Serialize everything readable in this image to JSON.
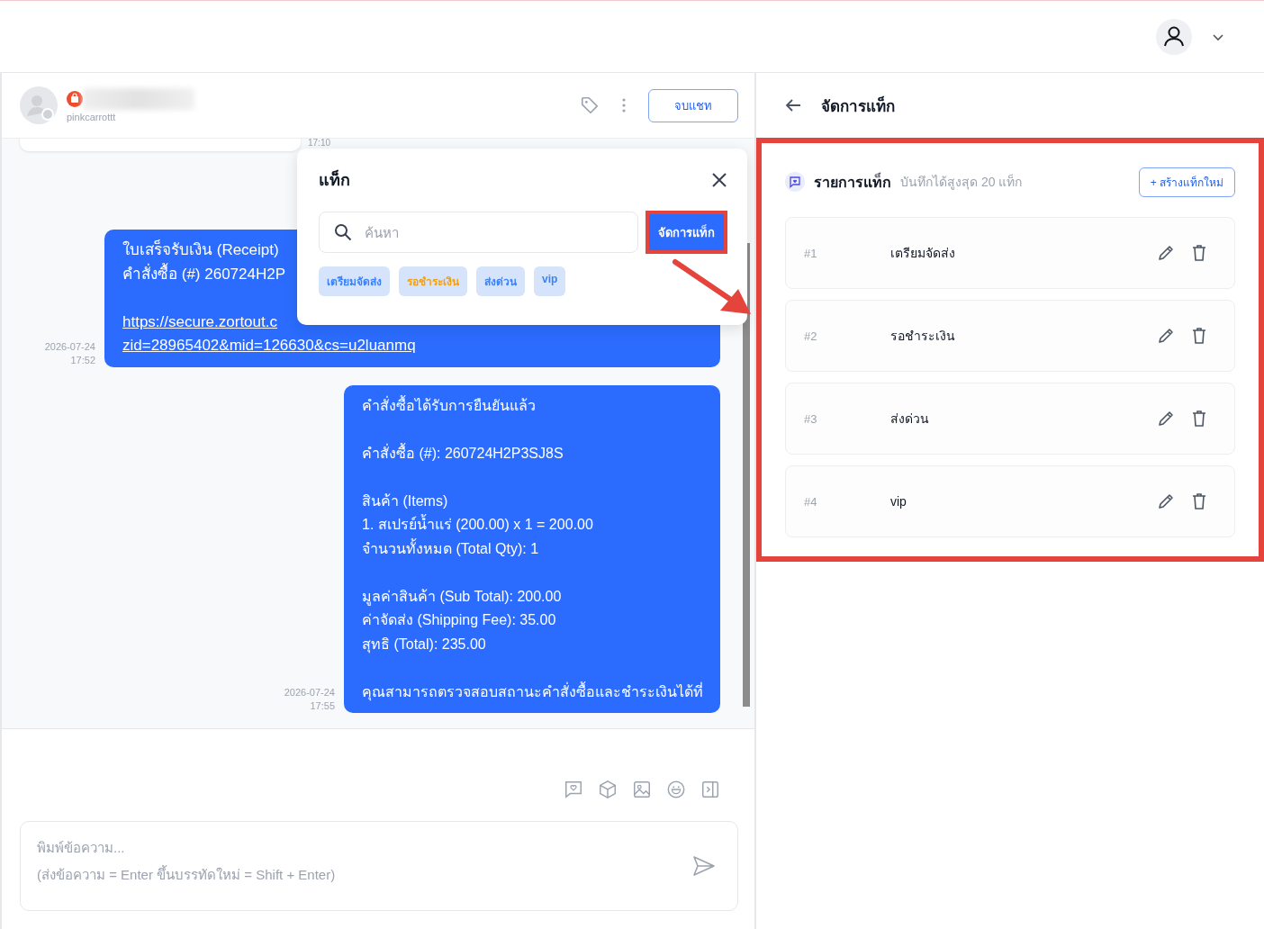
{
  "chat": {
    "contact": {
      "username": "pinkcarrottt"
    },
    "end_chat_button": "จบแชท",
    "messages": [
      {
        "kind": "cut_card",
        "time": "17:10"
      },
      {
        "kind": "bubble",
        "date": "2026-07-24",
        "time": "17:52",
        "lines": [
          {
            "kind": "text",
            "text": "ใบเสร็จรับเงิน (Receipt)"
          },
          {
            "kind": "text",
            "text": "คำสั่งซื้อ (#) 260724H2P"
          },
          {
            "kind": "gap"
          },
          {
            "kind": "link",
            "text": "https://secure.zortout.c"
          },
          {
            "kind": "link",
            "text": "zid=28965402&mid=126630&cs=u2luanmq"
          }
        ]
      },
      {
        "kind": "bubble",
        "date": "2026-07-24",
        "time": "17:55",
        "lines": [
          {
            "kind": "text",
            "text": "คำสั่งซื้อได้รับการยืนยันแล้ว"
          },
          {
            "kind": "gap"
          },
          {
            "kind": "text",
            "text": "คำสั่งซื้อ (#): 260724H2P3SJ8S"
          },
          {
            "kind": "gap"
          },
          {
            "kind": "text",
            "text": "สินค้า (Items)"
          },
          {
            "kind": "text",
            "text": "1. สเปรย์น้ำแร่ (200.00) x 1 = 200.00"
          },
          {
            "kind": "text",
            "text": "จำนวนทั้งหมด (Total Qty): 1"
          },
          {
            "kind": "gap"
          },
          {
            "kind": "text",
            "text": "มูลค่าสินค้า (Sub Total): 200.00"
          },
          {
            "kind": "text",
            "text": "ค่าจัดส่ง (Shipping Fee): 35.00"
          },
          {
            "kind": "text",
            "text": "สุทธิ (Total): 235.00"
          },
          {
            "kind": "gap"
          },
          {
            "kind": "text",
            "text": "คุณสามารถตรวจสอบสถานะคำสั่งซื้อและชำระเงินได้ที่"
          }
        ]
      }
    ],
    "composer": {
      "placeholder": "พิมพ์ข้อความ...\n(ส่งข้อความ = Enter ขึ้นบรรทัดใหม่ = Shift + Enter)"
    }
  },
  "tag_popover": {
    "title": "แท็ก",
    "search_placeholder": "ค้นหา",
    "manage_button": "จัดการแท็ก",
    "tags": [
      {
        "label": "เตรียมจัดส่ง",
        "color": "#3b82f6"
      },
      {
        "label": "รอชำระเงิน",
        "color": "#f59e0b"
      },
      {
        "label": "ส่งด่วน",
        "color": "#3b82f6"
      },
      {
        "label": "vip",
        "color": "#3b82f6"
      }
    ]
  },
  "tag_manager": {
    "title": "จัดการแท็ก",
    "list_title": "รายการแท็ก",
    "limit_note": "บันทึกได้สูงสุด 20 แท็ก",
    "create_button": "+ สร้างแท็กใหม่",
    "tags": [
      {
        "number": "#1",
        "name": "เตรียมจัดส่ง"
      },
      {
        "number": "#2",
        "name": "รอชำระเงิน"
      },
      {
        "number": "#3",
        "name": "ส่งด่วน"
      },
      {
        "number": "#4",
        "name": "vip"
      }
    ]
  }
}
